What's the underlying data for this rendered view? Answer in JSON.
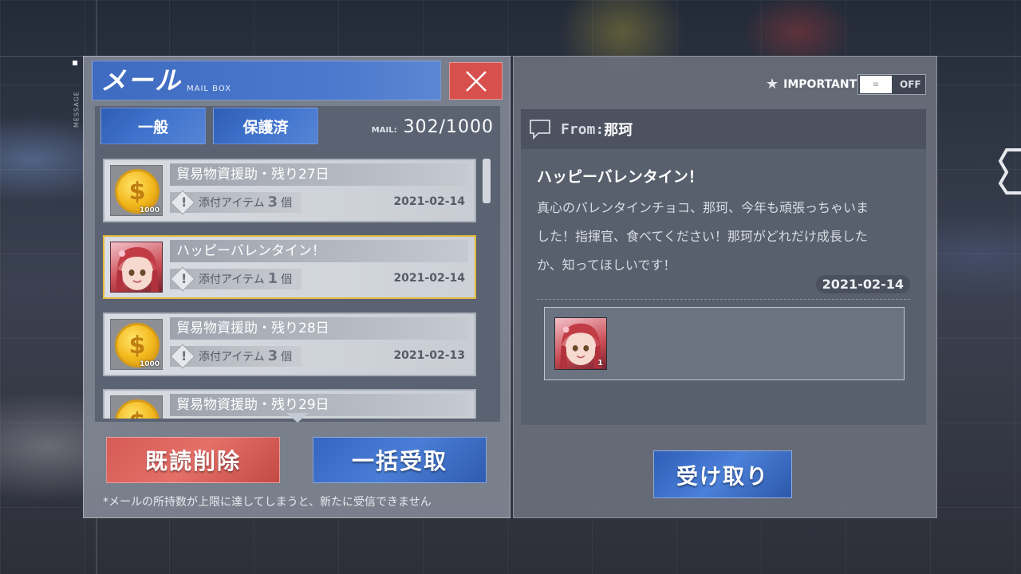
{
  "side_label": "MESSAGE",
  "header": {
    "title": "メール",
    "subtitle": "MAIL BOX"
  },
  "tabs": [
    {
      "label": "一般"
    },
    {
      "label": "保護済"
    }
  ],
  "mail_count": {
    "label": "MAIL:",
    "value": "302/1000"
  },
  "mails": [
    {
      "subject": "貿易物資援助・残り27日",
      "attach_label": "添付アイテム",
      "attach_count": "3",
      "attach_unit": "個",
      "date": "2021-02-14",
      "thumb": "gold-coin-icon",
      "thumb_amount": "1000"
    },
    {
      "subject": "ハッピーバレンタイン！",
      "attach_label": "添付アイテム",
      "attach_count": "1",
      "attach_unit": "個",
      "date": "2021-02-14",
      "thumb": "character-portrait"
    },
    {
      "subject": "貿易物資援助・残り28日",
      "attach_label": "添付アイテム",
      "attach_count": "3",
      "attach_unit": "個",
      "date": "2021-02-13",
      "thumb": "gold-coin-icon",
      "thumb_amount": "1000"
    },
    {
      "subject": "貿易物資援助・残り29日",
      "thumb": "gold-coin-icon"
    }
  ],
  "buttons": {
    "delete_read": "既読削除",
    "collect_all": "一括受取",
    "receive": "受け取り"
  },
  "note": "*メールの所持数が上限に達してしまうと、新たに受信できません",
  "important": {
    "label": "IMPORTANT",
    "toggle_state": "OFF"
  },
  "message": {
    "from_label": "From:",
    "from_name": "那珂",
    "title": "ハッピーバレンタイン！",
    "body_line1": "真心のバレンタインチョコ、那珂、今年も頑張っちゃいま",
    "body_line2": "した！指揮官、食べてください！那珂がどれだけ成長した",
    "body_line3": "か、知ってほしいです！",
    "date": "2021-02-14",
    "attachment_qty": "1"
  },
  "colors": {
    "accent_blue": "#3f72cc",
    "delete_red": "#d65c56",
    "selected_border": "#e4b93d"
  }
}
